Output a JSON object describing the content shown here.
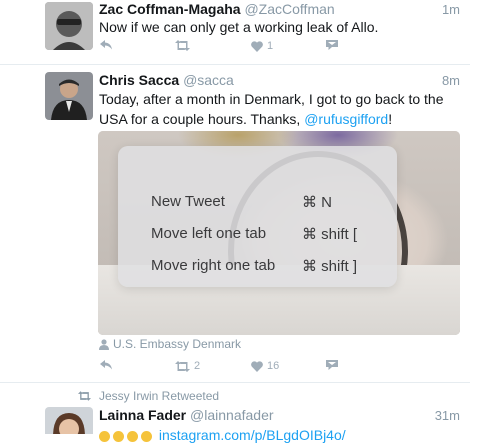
{
  "tweets": [
    {
      "name": "Zac Coffman-Magaha",
      "handle": "@ZacCoffman",
      "time": "1m",
      "text": "Now if we can only get a working leak of Allo.",
      "like_count": "1",
      "retweet_count": ""
    },
    {
      "name": "Chris Sacca",
      "handle": "@sacca",
      "time": "8m",
      "text_line1": "Today, after a month in Denmark, I got to go back to the",
      "text_line2": "USA for a couple hours. Thanks,",
      "mention": "@rufusgifford",
      "text_end": "!",
      "location": "U.S. Embassy Denmark",
      "retweet_count": "2",
      "like_count": "16"
    },
    {
      "retweeted_by": "Jessy Irwin Retweeted",
      "name": "Lainna Fader",
      "handle": "@lainnafader",
      "time": "31m",
      "text": "instagram.com/p/BLgdOIBj4o/"
    }
  ],
  "shortcuts": [
    {
      "label": "New Tweet",
      "keys": "⌘ N"
    },
    {
      "label": "Move left one tab",
      "keys": "⌘ shift ["
    },
    {
      "label": "Move right one tab",
      "keys": "⌘ shift ]"
    }
  ],
  "colors": {
    "link": "#1da1f2",
    "muted": "#8899a6",
    "icon": "#a0adb8"
  }
}
